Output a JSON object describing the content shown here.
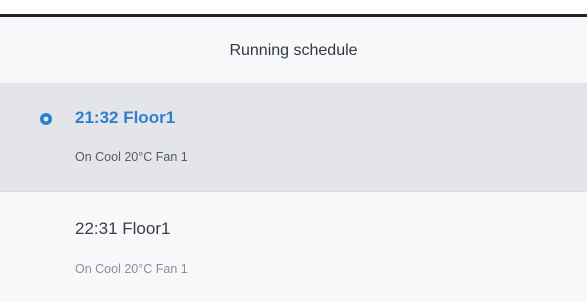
{
  "header": {
    "title": "Running schedule"
  },
  "schedule": [
    {
      "time_location": "21:32 Floor1",
      "detail": "On Cool 20°C Fan 1",
      "active": true
    },
    {
      "time_location": "22:31 Floor1",
      "detail": "On Cool 20°C Fan 1",
      "active": false
    }
  ],
  "colors": {
    "accent": "#2f7fd0",
    "active_row_bg": "#e3e5e9",
    "row_bg": "#f7f8fa",
    "top_bar": "#1e2430"
  },
  "icons": {
    "active_indicator": "current-schedule-indicator-icon"
  }
}
